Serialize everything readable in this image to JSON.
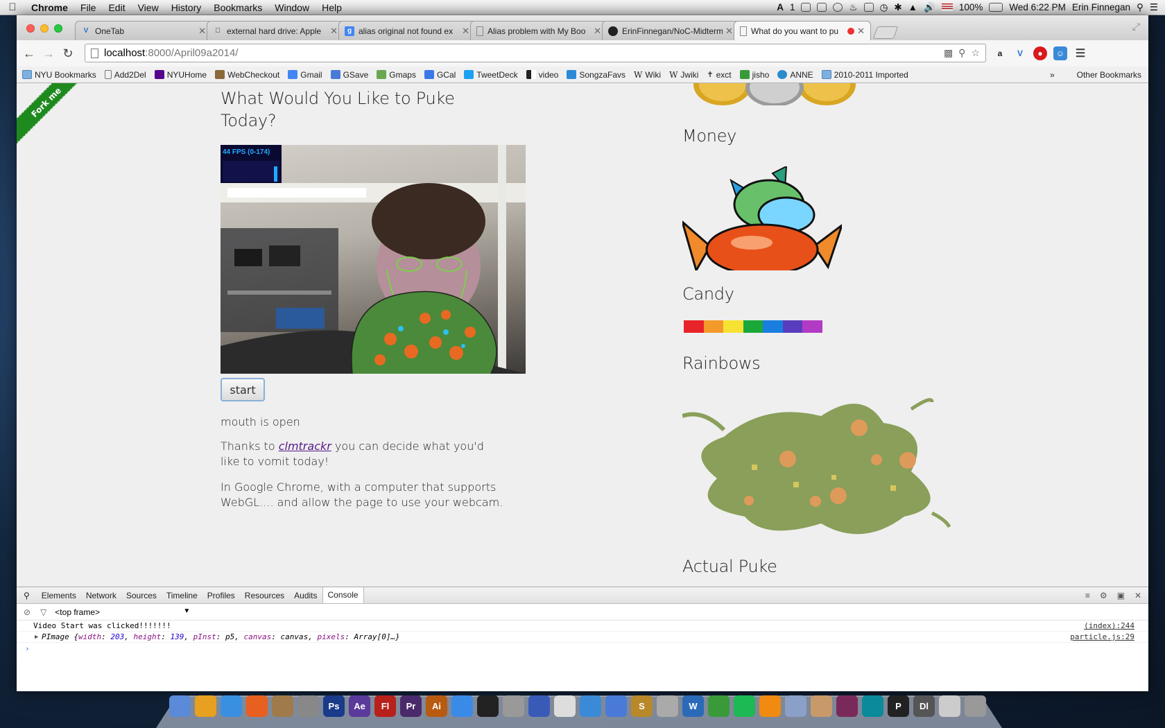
{
  "menubar": {
    "app": "Chrome",
    "items": [
      "File",
      "Edit",
      "View",
      "History",
      "Bookmarks",
      "Window",
      "Help"
    ],
    "status_text": "1",
    "battery": "100%",
    "clock": "Wed 6:22 PM",
    "user": "Erin Finnegan"
  },
  "tabs": [
    {
      "label": "OneTab",
      "fav": "V",
      "color": "#2b6fd6"
    },
    {
      "label": "external hard drive: Apple",
      "fav": "",
      "color": "#555"
    },
    {
      "label": "alias original not found ex",
      "fav": "g",
      "color": "#4285f4"
    },
    {
      "label": "Alias problem with My Boo",
      "fav": "",
      "color": "#888"
    },
    {
      "label": "ErinFinnegan/NoC-Midterm",
      "fav": "",
      "color": "#222"
    },
    {
      "label": "What do you want to pu",
      "fav": "",
      "color": "#888"
    }
  ],
  "toolbar": {
    "url_host": "localhost",
    "url_rest": ":8000/April09a2014/"
  },
  "bookmarks": [
    "NYU Bookmarks",
    "Add2Del",
    "NYUHome",
    "WebCheckout",
    "Gmail",
    "GSave",
    "Gmaps",
    "GCal",
    "TweetDeck",
    "video",
    "SongzaFavs",
    "Wiki",
    "Jwiki",
    "exct",
    "jisho",
    "ANNE",
    "2010-2011 Imported"
  ],
  "bookmarks_other": "Other Bookmarks",
  "page": {
    "ribbon": "Fork me",
    "title": "What Would You Like to Puke Today?",
    "fps": "44 FPS (0-174)",
    "start": "start",
    "status": "mouth is open",
    "para1_pre": "Thanks to ",
    "para1_link": "clmtrackr",
    "para1_post": " you can decide what you'd like to vomit today!",
    "para2": "In Google Chrome, with a computer that supports WebGL.... and allow the page to use your webcam.",
    "h_money": "Money",
    "h_candy": "Candy",
    "h_rainbows": "Rainbows",
    "h_puke": "Actual Puke",
    "rainbow_colors": [
      "#e8232a",
      "#f39a2a",
      "#f7e233",
      "#1aa83a",
      "#1a7de0",
      "#5a3dbd",
      "#b13bc4"
    ]
  },
  "devtools": {
    "tabs": [
      "Elements",
      "Network",
      "Sources",
      "Timeline",
      "Profiles",
      "Resources",
      "Audits",
      "Console"
    ],
    "frame": "<top frame>",
    "log1": "Video Start was clicked!!!!!!!",
    "log1_src": "(index):244",
    "log2_src": "particle.js:29",
    "log2_width": "203",
    "log2_height": "139"
  },
  "dock": [
    "Finder",
    "Chrome",
    "Safari",
    "Firefox",
    "Notes",
    "Sys",
    "Ps",
    "Ae",
    "Fl",
    "Pr",
    "Ai",
    "Msg",
    "Term",
    "Cam",
    "Desk",
    "Preview",
    "iTunes",
    "Mail",
    "S",
    "Calc",
    "W",
    "Apps",
    "Spotify",
    "VLC",
    "Img",
    "Photo",
    "Game",
    "Arduino",
    "P",
    "Dl",
    "Docs",
    "Trash"
  ]
}
